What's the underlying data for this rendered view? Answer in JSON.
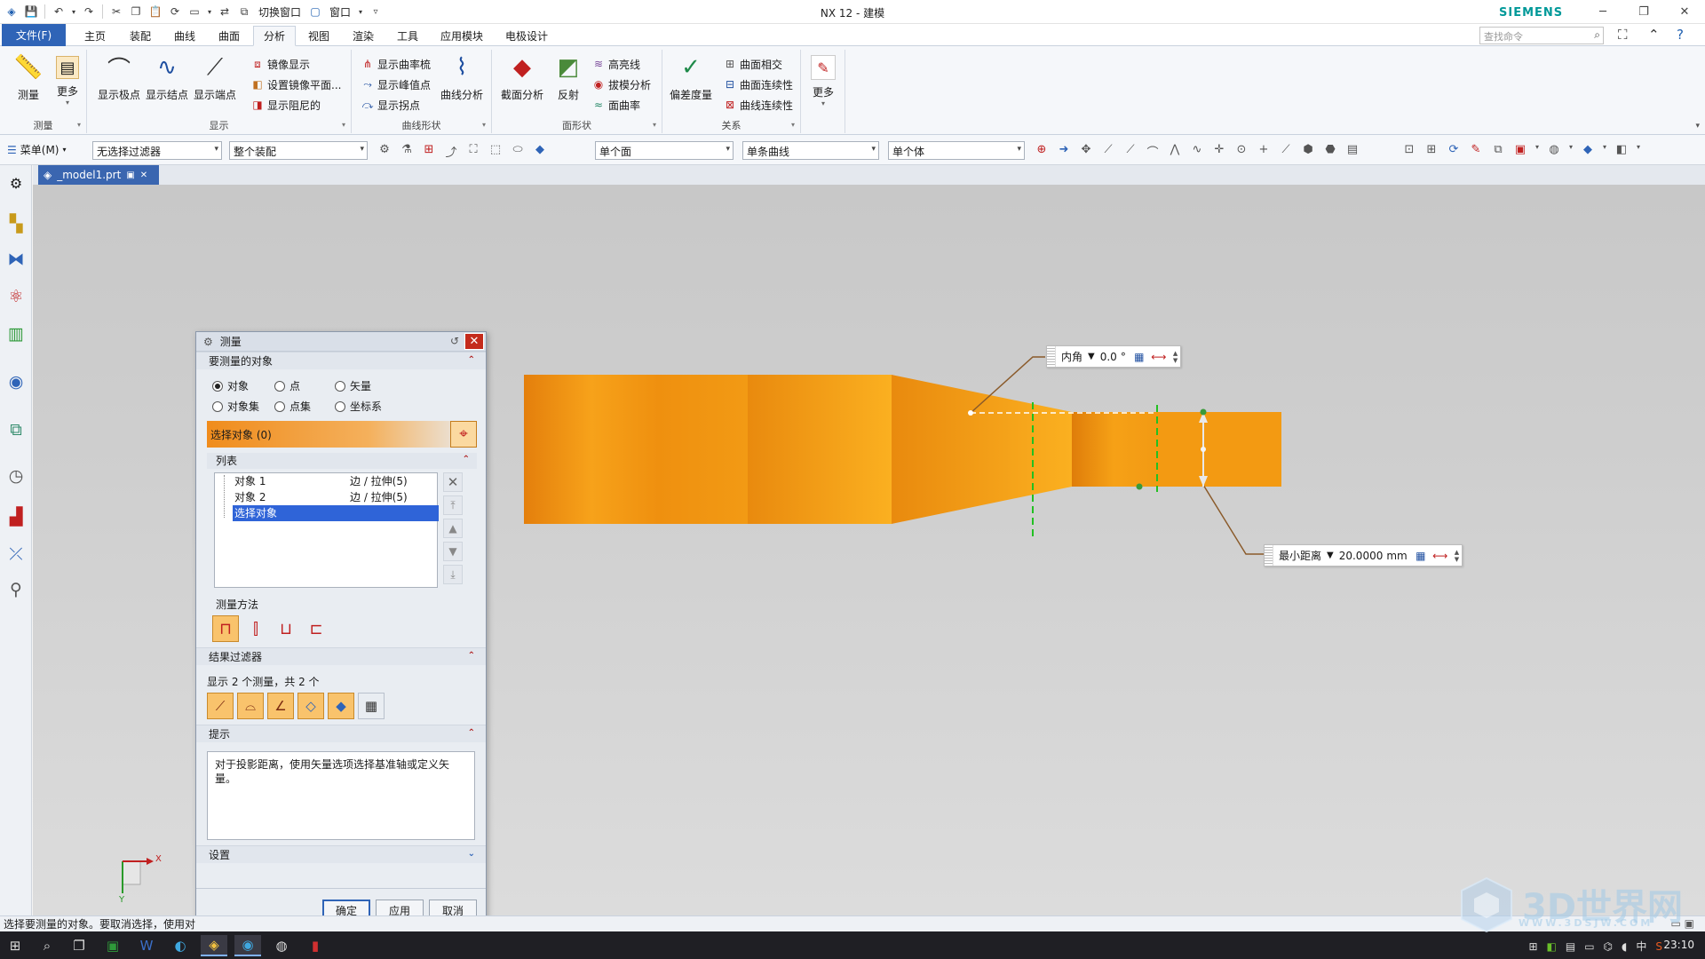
{
  "window": {
    "title": "NX 12 - 建模",
    "brand": "SIEMENS"
  },
  "qat": {
    "switch_window": "切换窗口",
    "window": "窗口"
  },
  "tabs": {
    "file": "文件(F)",
    "items": [
      "主页",
      "装配",
      "曲线",
      "曲面",
      "分析",
      "视图",
      "渲染",
      "工具",
      "应用模块",
      "电极设计"
    ],
    "active": "分析"
  },
  "search": {
    "placeholder": "查找命令"
  },
  "ribbon": {
    "measure_group": {
      "label": "测量",
      "measure": "测量",
      "more": "更多"
    },
    "display_group": {
      "label": "显示",
      "show_poles": "显示极点",
      "show_knots": "显示结点",
      "show_endpoints": "显示端点",
      "mirror_display": "镜像显示",
      "set_mirror_plane": "设置镜像平面...",
      "show_damping": "显示阻尼的"
    },
    "curve_shape_group": {
      "label": "曲线形状",
      "show_curvature_comb": "显示曲率梳",
      "show_peaks": "显示峰值点",
      "show_inflections": "显示拐点",
      "curve_analysis": "曲线分析"
    },
    "face_shape_group": {
      "label": "面形状",
      "section_analysis": "截面分析",
      "reflection": "反射",
      "highlight_lines": "高亮线",
      "draft_analysis": "拔模分析",
      "face_curvature": "面曲率"
    },
    "relation_group": {
      "label": "关系",
      "deviation": "偏差度量",
      "face_intersection": "曲面相交",
      "face_continuity": "曲面连续性",
      "curve_continuity": "曲线连续性"
    },
    "more_group": {
      "more": "更多"
    }
  },
  "selbar": {
    "menu": "菜单(M)",
    "filter": "无选择过滤器",
    "scope": "整个装配",
    "face_rule": "单个面",
    "curve_rule": "单条曲线",
    "body_rule": "单个体"
  },
  "doc": {
    "tab": "_model1.prt"
  },
  "dims": {
    "angle": {
      "type": "内角",
      "value": "0.0",
      "unit": "°"
    },
    "distance": {
      "type": "最小距离",
      "value": "20.0000",
      "unit": "mm"
    }
  },
  "triad": {
    "x": "X",
    "y": "Y"
  },
  "dialog": {
    "title": "测量",
    "section_objects": "要测量的对象",
    "radios": [
      "对象",
      "点",
      "矢量",
      "对象集",
      "点集",
      "坐标系"
    ],
    "select_object": "选择对象 (0)",
    "list_header": "列表",
    "list_rows": [
      {
        "name": "对象 1",
        "type": "边 / 拉伸(5)"
      },
      {
        "name": "对象 2",
        "type": "边 / 拉伸(5)"
      }
    ],
    "list_selected": "选择对象",
    "method_label": "测量方法",
    "section_filter": "结果过滤器",
    "filter_text": "显示 2 个测量，共 2 个",
    "section_hint": "提示",
    "hint_text": "对于投影距离，使用矢量选项选择基准轴或定义矢量。",
    "section_settings": "设置",
    "ok": "确定",
    "apply": "应用",
    "cancel": "取消"
  },
  "status": {
    "text": "选择要测量的对象。要取消选择，使用对"
  },
  "taskbar": {
    "time": "23:10",
    "ime": "中"
  },
  "watermark": {
    "main": "3D世界网",
    "sub": "WWW.3DSJW.COM"
  },
  "colors": {
    "part_orange": "#f39a12",
    "accent_blue": "#2f64b7",
    "dim_leader": "#8a5a2a",
    "green_guides": "#22c022"
  }
}
